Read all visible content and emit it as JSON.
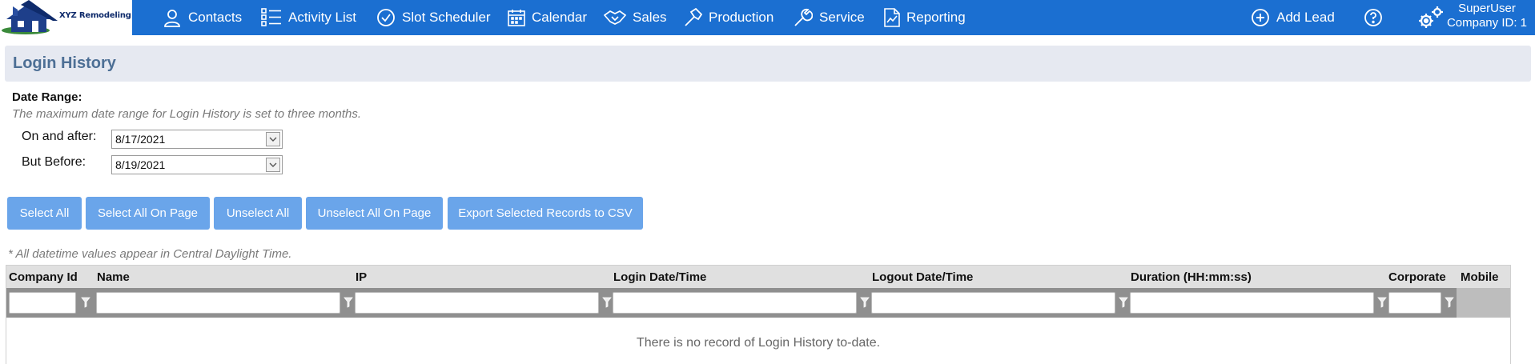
{
  "brand": {
    "name": "XYZ Remodeling"
  },
  "nav": {
    "contacts": "Contacts",
    "activity_list": "Activity List",
    "slot_scheduler": "Slot Scheduler",
    "calendar": "Calendar",
    "sales": "Sales",
    "production": "Production",
    "service": "Service",
    "reporting": "Reporting",
    "add_lead": "Add Lead"
  },
  "user": {
    "name": "SuperUser",
    "company": "Company ID: 1"
  },
  "page": {
    "title": "Login History"
  },
  "date_range": {
    "label": "Date Range:",
    "note": "The maximum date range for Login History is set to three months.",
    "on_after_label": "On and after:",
    "on_after_value": "8/17/2021",
    "before_label": "But Before:",
    "before_value": "8/19/2021"
  },
  "actions": {
    "select_all": "Select All",
    "select_all_page": "Select All On Page",
    "unselect_all": "Unselect All",
    "unselect_all_page": "Unselect All On Page",
    "export_csv": "Export Selected Records to CSV"
  },
  "timezone_note": "* All datetime values appear in Central Daylight Time.",
  "table": {
    "columns": [
      "Company Id",
      "Name",
      "IP",
      "Login Date/Time",
      "Logout Date/Time",
      "Duration (HH:mm:ss)",
      "Corporate",
      "Mobile"
    ],
    "empty_message": "There is no record of Login History to-date."
  },
  "colors": {
    "nav_bg": "#1b6fd1",
    "button_bg": "#6aa5ea",
    "title_text": "#4d6f95"
  }
}
